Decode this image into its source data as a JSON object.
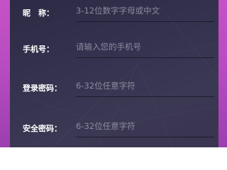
{
  "form": {
    "fields": [
      {
        "label": "昵　称：",
        "placeholder": "3-12位数字字母或中文"
      },
      {
        "label": "手机号：",
        "placeholder": "请输入您的手机号"
      },
      {
        "label": "登录密码：",
        "placeholder": "6-32位任意字符"
      },
      {
        "label": "安全密码：",
        "placeholder": "6-32位任意字符"
      }
    ]
  },
  "colors": {
    "background": "#c452c6",
    "panel": "#33314d",
    "label": "#ffffff",
    "placeholder": "#8c8a9f",
    "underline": "#1d1b2c"
  }
}
